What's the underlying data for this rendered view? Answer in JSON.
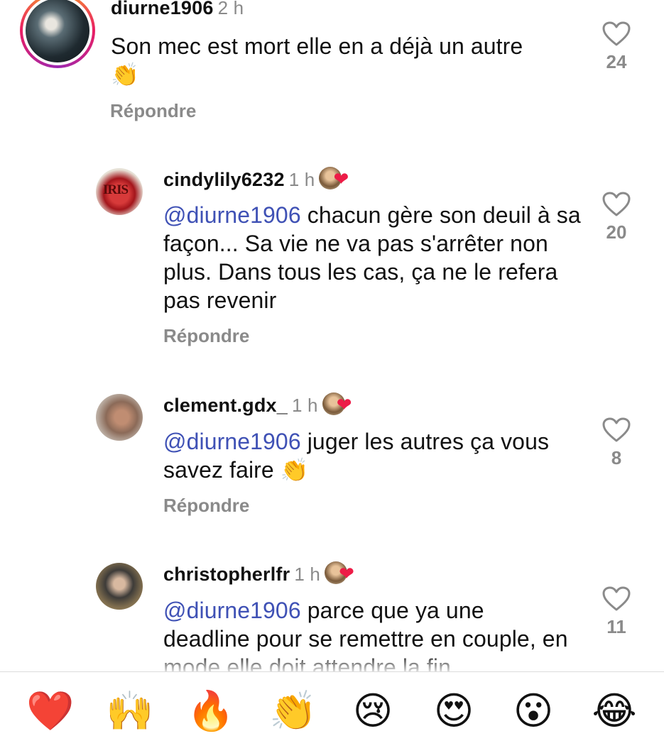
{
  "comments": [
    {
      "username": "diurne1906",
      "time": "2 h",
      "text": "Son mec est mort elle en a déjà un autre",
      "emoji": "👏",
      "likes": "24",
      "reply_label": "Répondre",
      "avatar_icon": "profile-photo"
    },
    {
      "username": "cindylily6232",
      "time": "1 h",
      "mention": "@diurne1906",
      "text": " chacun gère son deuil à sa façon... Sa vie ne va pas s'arrêter non plus. Dans tous les cas, ça ne le refera pas revenir",
      "avatar_text": "IRIS",
      "likes": "20",
      "reply_label": "Répondre"
    },
    {
      "username": "clement.gdx_",
      "time": "1 h",
      "mention": "@diurne1906",
      "text": " juger les autres ça vous savez faire ",
      "emoji": "👏",
      "likes": "8",
      "reply_label": "Répondre"
    },
    {
      "username": "christopherlfr",
      "time": "1 h",
      "mention": "@diurne1906",
      "text": " parce que ya une deadline pour se remettre en couple, en mode elle doit attendre la fin",
      "likes": "11"
    }
  ],
  "creator_badge": {
    "icon": "creator-liked-badge",
    "heart": "❤"
  },
  "reactions": [
    {
      "name": "heart",
      "glyph": "❤️"
    },
    {
      "name": "raised-hands",
      "glyph": "🙌"
    },
    {
      "name": "fire",
      "glyph": "🔥"
    },
    {
      "name": "clapping-hands",
      "glyph": "👏"
    },
    {
      "name": "crying-face",
      "glyph": "😢"
    },
    {
      "name": "heart-eyes",
      "glyph": "😍"
    },
    {
      "name": "surprised-face",
      "glyph": "😮"
    },
    {
      "name": "tears-of-joy",
      "glyph": "😂"
    }
  ],
  "colors": {
    "mention": "#3f51b5",
    "secondary": "#8a8a8a",
    "heart": "#ed1c47"
  }
}
